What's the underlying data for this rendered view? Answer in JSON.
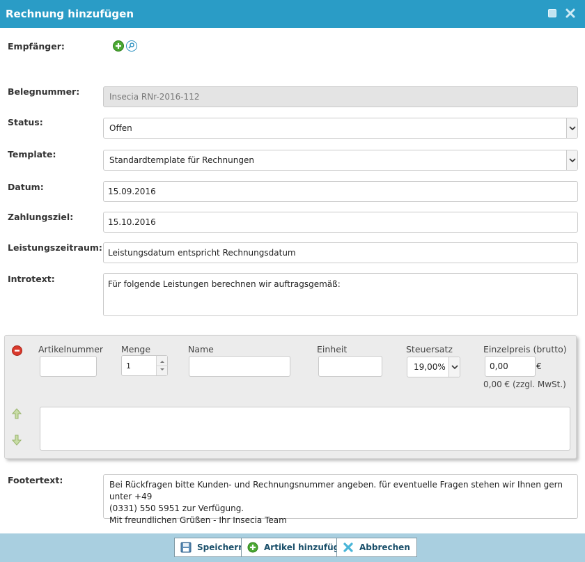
{
  "window": {
    "title": "Rechnung hinzufügen",
    "maximize_icon": "maximize-icon",
    "close_icon": "close-icon"
  },
  "form": {
    "recipient": {
      "label": "Empfänger:",
      "add_icon": "add-icon",
      "search_icon": "search-icon"
    },
    "invoice_number": {
      "label": "Belegnummer:",
      "value": "Insecia RNr-2016-112"
    },
    "status": {
      "label": "Status:",
      "value": "Offen"
    },
    "template": {
      "label": "Template:",
      "value": "Standardtemplate für Rechnungen"
    },
    "date": {
      "label": "Datum:",
      "value": "15.09.2016"
    },
    "payment_due": {
      "label": "Zahlungsziel:",
      "value": "15.10.2016"
    },
    "service_period": {
      "label": "Leistungszeitraum:",
      "value": "Leistungsdatum entspricht Rechnungsdatum"
    },
    "intro": {
      "label": "Introtext:",
      "value": "Für folgende Leistungen berechnen wir auftragsgemäß:"
    },
    "footer": {
      "label": "Footertext:",
      "lines": [
        "Bei Rückfragen bitte Kunden- und Rechnungsnummer angeben. für eventuelle Fragen stehen wir Ihnen gern unter +49",
        "(0331) 550 5951 zur Verfügung.",
        "Mit freundlichen Grüßen - Ihr Insecia Team"
      ]
    }
  },
  "article": {
    "remove_icon": "remove-icon",
    "headers": {
      "article_number": "Artikelnummer",
      "quantity": "Menge",
      "name": "Name",
      "unit": "Einheit",
      "tax_rate": "Steuersatz",
      "unit_price": "Einzelpreis (brutto)"
    },
    "values": {
      "article_number": "",
      "quantity": "1",
      "name": "",
      "unit": "",
      "tax_rate": "19,00%",
      "unit_price": "0,00",
      "currency": "€",
      "net_note": "0,00 € (zzgl. MwSt.)",
      "description": ""
    },
    "move_up_icon": "arrow-up-icon",
    "move_down_icon": "arrow-down-icon"
  },
  "buttons": {
    "save": "Speichern",
    "add_article": "Artikel hinzufügen",
    "cancel": "Abbrechen"
  },
  "colors": {
    "titlebar": "#2a9cc6",
    "bottombar": "#a9cfe0",
    "panel": "#ececec"
  }
}
